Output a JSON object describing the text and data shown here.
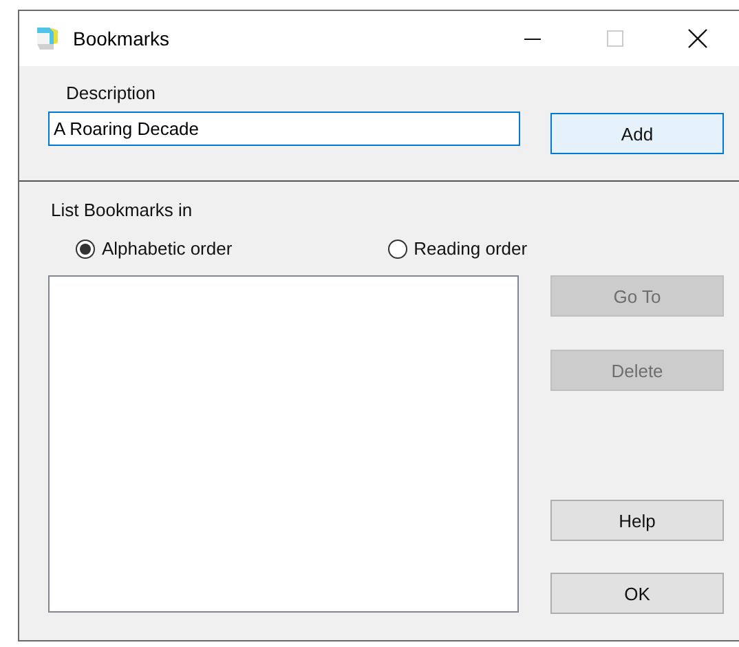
{
  "window": {
    "title": "Bookmarks"
  },
  "description": {
    "label": "Description",
    "value": "A Roaring Decade"
  },
  "add_button": {
    "label": "Add",
    "disabled": false
  },
  "list_section": {
    "label": "List Bookmarks in",
    "options": [
      {
        "label": "Alphabetic order",
        "selected": true
      },
      {
        "label": "Reading order",
        "selected": false
      }
    ]
  },
  "buttons": [
    {
      "label": "Go To",
      "disabled": true
    },
    {
      "label": "Delete",
      "disabled": true
    },
    {
      "label": "Help",
      "disabled": false
    },
    {
      "label": "OK",
      "disabled": false
    }
  ]
}
